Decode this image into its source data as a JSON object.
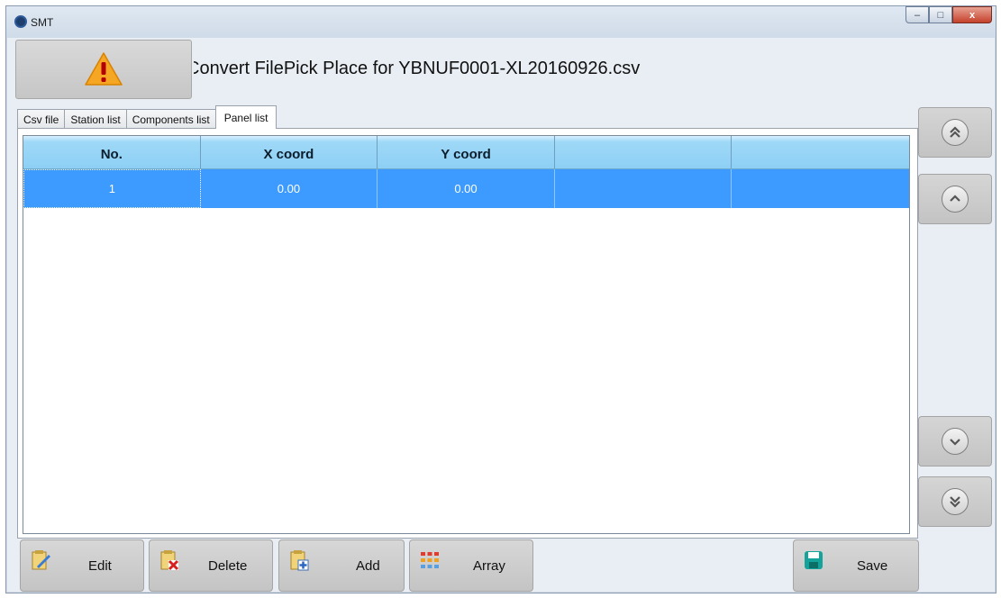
{
  "window": {
    "title": "SMT",
    "min_glyph": "–",
    "max_glyph": "□",
    "close_glyph": "x"
  },
  "header": {
    "status_text": "Convert FilePick Place for YBNUF0001-XL20160926.csv"
  },
  "tabs": [
    {
      "label": "Csv file",
      "active": false
    },
    {
      "label": "Station list",
      "active": false
    },
    {
      "label": "Components list",
      "active": false
    },
    {
      "label": "Panel list",
      "active": true
    }
  ],
  "table": {
    "columns": [
      "No.",
      "X coord",
      "Y coord",
      "",
      ""
    ],
    "rows": [
      {
        "no": "1",
        "x": "0.00",
        "y": "0.00",
        "c4": "",
        "c5": "",
        "selected": true
      }
    ]
  },
  "nav_buttons": [
    "first-page-icon",
    "page-up-icon",
    "page-down-icon",
    "last-page-icon"
  ],
  "toolbar": {
    "edit_label": "Edit",
    "delete_label": "Delete",
    "add_label": "Add",
    "array_label": "Array",
    "save_label": "Save"
  },
  "colors": {
    "header_bg": "#8dd0f5",
    "selected_row": "#3d9bff",
    "warning": "#f5a623"
  }
}
